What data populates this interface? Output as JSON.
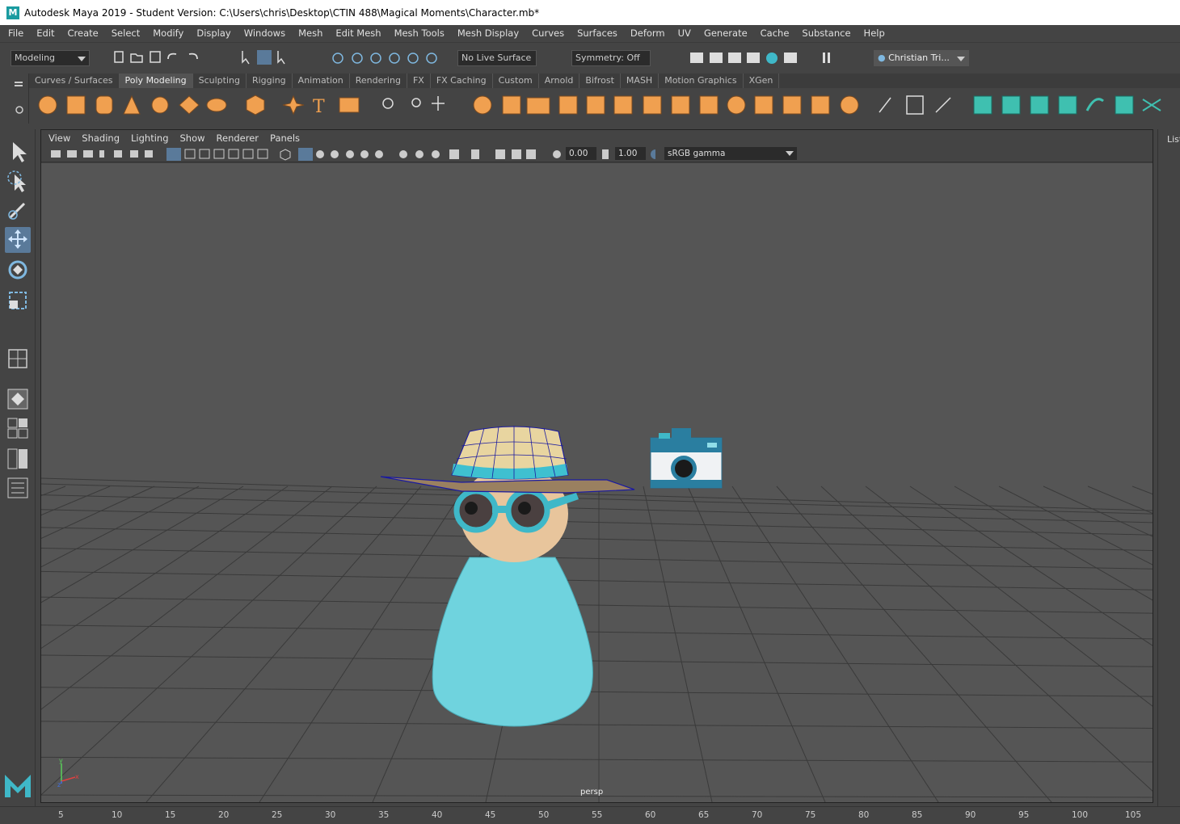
{
  "window": {
    "title": "Autodesk Maya 2019 - Student Version: C:\\Users\\chris\\Desktop\\CTIN 488\\Magical Moments\\Character.mb*",
    "logo_letter": "M"
  },
  "menubar": [
    "File",
    "Edit",
    "Create",
    "Select",
    "Modify",
    "Display",
    "Windows",
    "Mesh",
    "Edit Mesh",
    "Mesh Tools",
    "Mesh Display",
    "Curves",
    "Surfaces",
    "Deform",
    "UV",
    "Generate",
    "Cache",
    "Substance",
    "Help"
  ],
  "statusline": {
    "menuset": "Modeling",
    "live_surface": "No Live Surface",
    "symmetry": "Symmetry: Off",
    "user": "Christian Tri..."
  },
  "shelf_tabs": [
    "Curves / Surfaces",
    "Poly Modeling",
    "Sculpting",
    "Rigging",
    "Animation",
    "Rendering",
    "FX",
    "FX Caching",
    "Custom",
    "Arnold",
    "Bifrost",
    "MASH",
    "Motion Graphics",
    "XGen"
  ],
  "active_shelf_tab": "Poly Modeling",
  "panel_menu": [
    "View",
    "Shading",
    "Lighting",
    "Show",
    "Renderer",
    "Panels"
  ],
  "panel_tools": {
    "exposure": "0.00",
    "gamma": "1.00",
    "color_space": "sRGB gamma"
  },
  "viewport": {
    "camera_label": "persp",
    "background_color": "#555555",
    "character_body_color": "#6fd3de",
    "accent_color": "#3fb8c8"
  },
  "right_panel": {
    "label": "List"
  },
  "timeline": {
    "ticks": [
      "5",
      "10",
      "15",
      "20",
      "25",
      "30",
      "35",
      "40",
      "45",
      "50",
      "55",
      "60",
      "65",
      "70",
      "75",
      "80",
      "85",
      "90",
      "95",
      "100",
      "105"
    ]
  },
  "colors": {
    "orange_icon": "#f0a050",
    "teal_icon": "#3fc0b0",
    "active_tool": "#5a7a9a"
  }
}
